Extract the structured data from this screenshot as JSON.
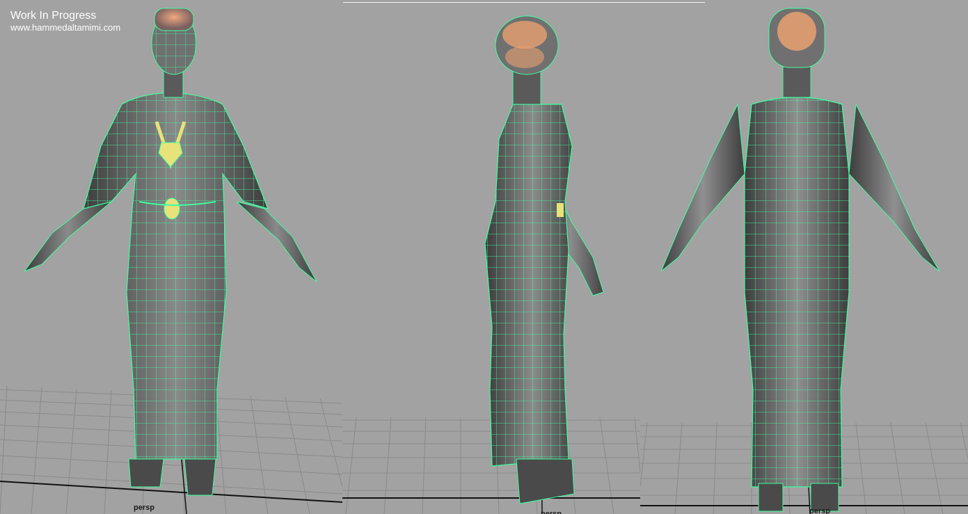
{
  "overlay": {
    "title": "Work In Progress",
    "url": "www.hammedaltamimi.com"
  },
  "viewports": [
    {
      "camera": "persp",
      "view": "front"
    },
    {
      "camera": "persp",
      "view": "side"
    },
    {
      "camera": "persp",
      "view": "back"
    }
  ],
  "colors": {
    "background": "#a2a2a2",
    "mesh_fill": "#6e6e6e",
    "wireframe": "#3dffa0",
    "accent_gold": "#e8e27a",
    "headgear": "#e8a070"
  }
}
